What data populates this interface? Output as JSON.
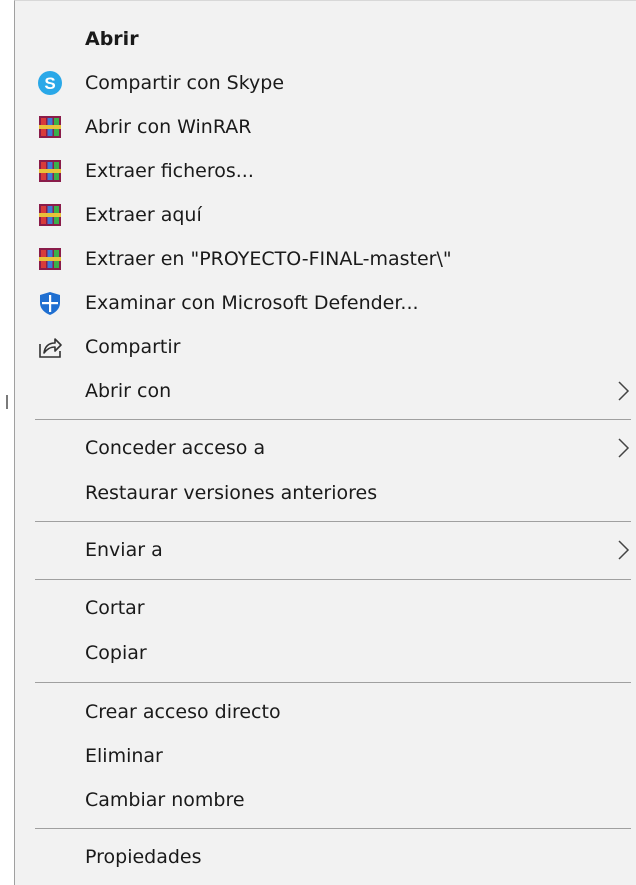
{
  "menu": {
    "items": {
      "open": "Abrir",
      "share_skype": "Compartir con Skype",
      "open_winrar": "Abrir con WinRAR",
      "extract_files": "Extraer ficheros...",
      "extract_here": "Extraer aquí",
      "extract_to": "Extraer en \"PROYECTO-FINAL-master\\\"",
      "defender_scan": "Examinar con Microsoft Defender...",
      "share": "Compartir",
      "open_with": "Abrir con",
      "give_access": "Conceder acceso a",
      "restore_versions": "Restaurar versiones anteriores",
      "send_to": "Enviar a",
      "cut": "Cortar",
      "copy": "Copiar",
      "create_shortcut": "Crear acceso directo",
      "delete": "Eliminar",
      "rename": "Cambiar nombre",
      "properties": "Propiedades"
    },
    "icons": {
      "share_skype": "skype-icon",
      "open_winrar": "winrar-icon",
      "extract_files": "winrar-icon",
      "extract_here": "winrar-icon",
      "extract_to": "winrar-icon",
      "defender_scan": "defender-shield-icon",
      "share": "share-icon",
      "submenu_arrow": "chevron-right-icon"
    },
    "colors": {
      "background": "#f2f2f2",
      "text": "#1a1a1a",
      "separator": "#a0a0a0",
      "skype": "#2aa8e8",
      "defender": "#1f6fd1"
    }
  }
}
